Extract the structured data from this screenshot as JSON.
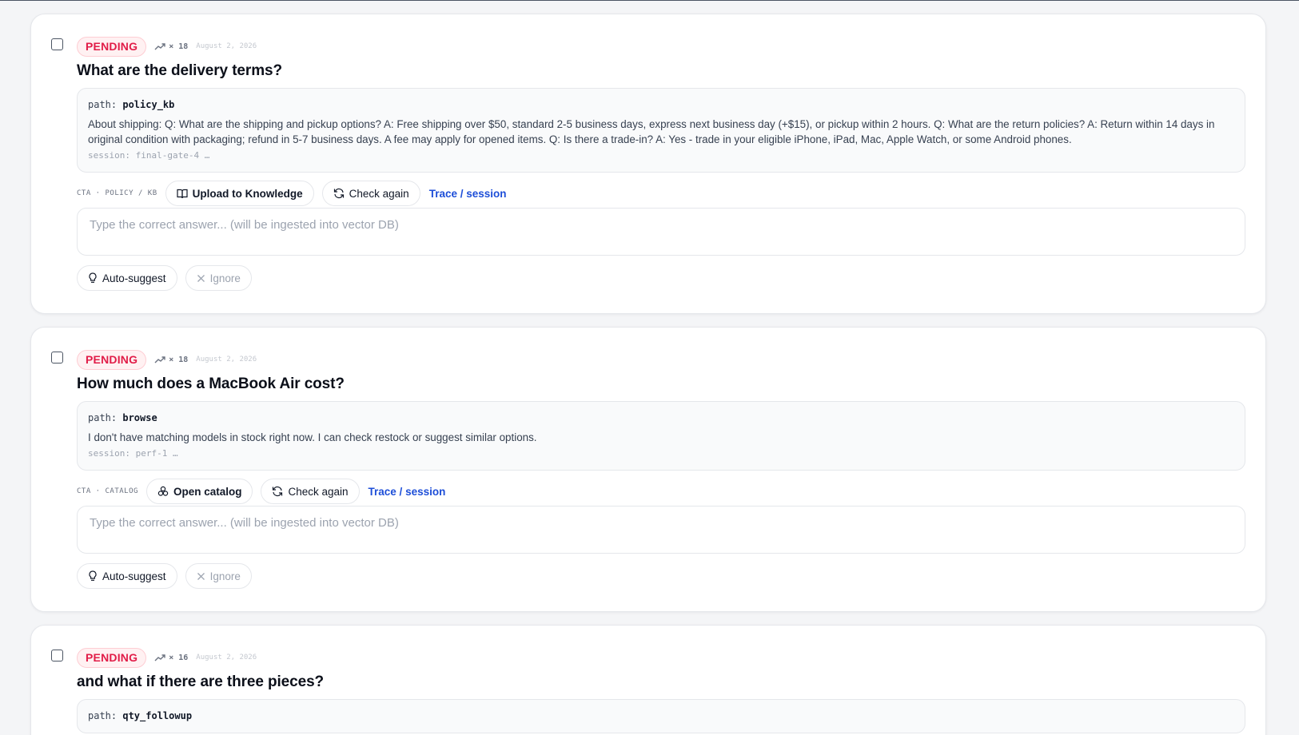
{
  "colors": {
    "badge_text": "#e11d48",
    "badge_bg": "#fff1f2",
    "link": "#1d4ed8",
    "page_bg": "#f4f5f7"
  },
  "cards": [
    {
      "status": "PENDING",
      "count": "× 18",
      "date": "August 2, 2026",
      "question": "What are the delivery terms?",
      "path_label": "path:",
      "path_value": "policy_kb",
      "answer": "About shipping: Q: What are the shipping and pickup options? A: Free shipping over $50, standard 2-5 business days, express next business day (+$15), or pickup within 2 hours. Q: What are the return policies? A: Return within 14 days in original condition with packaging; refund in 5-7 business days. A fee may apply for opened items. Q: Is there a trade-in? A: Yes - trade in your eligible iPhone, iPad, Mac, Apple Watch, or some Android phones.",
      "session": "session: final-gate-4 …",
      "cta_label": "CTA · POLICY / KB",
      "cta_button": "Upload to Knowledge",
      "cta_icon": "book-icon",
      "check_again": "Check again",
      "trace_link": "Trace / session",
      "input_placeholder": "Type the correct answer... (will be ingested into vector DB)",
      "auto_suggest": "Auto-suggest",
      "ignore": "Ignore"
    },
    {
      "status": "PENDING",
      "count": "× 18",
      "date": "August 2, 2026",
      "question": "How much does a MacBook Air cost?",
      "path_label": "path:",
      "path_value": "browse",
      "answer": "I don't have matching models in stock right now. I can check restock or suggest similar options.",
      "session": "session: perf-1 …",
      "cta_label": "CTA · CATALOG",
      "cta_button": "Open catalog",
      "cta_icon": "catalog-icon",
      "check_again": "Check again",
      "trace_link": "Trace / session",
      "input_placeholder": "Type the correct answer... (will be ingested into vector DB)",
      "auto_suggest": "Auto-suggest",
      "ignore": "Ignore"
    },
    {
      "status": "PENDING",
      "count": "× 16",
      "date": "August 2, 2026",
      "question": "and what if there are three pieces?",
      "path_label": "path:",
      "path_value": "qty_followup"
    }
  ]
}
